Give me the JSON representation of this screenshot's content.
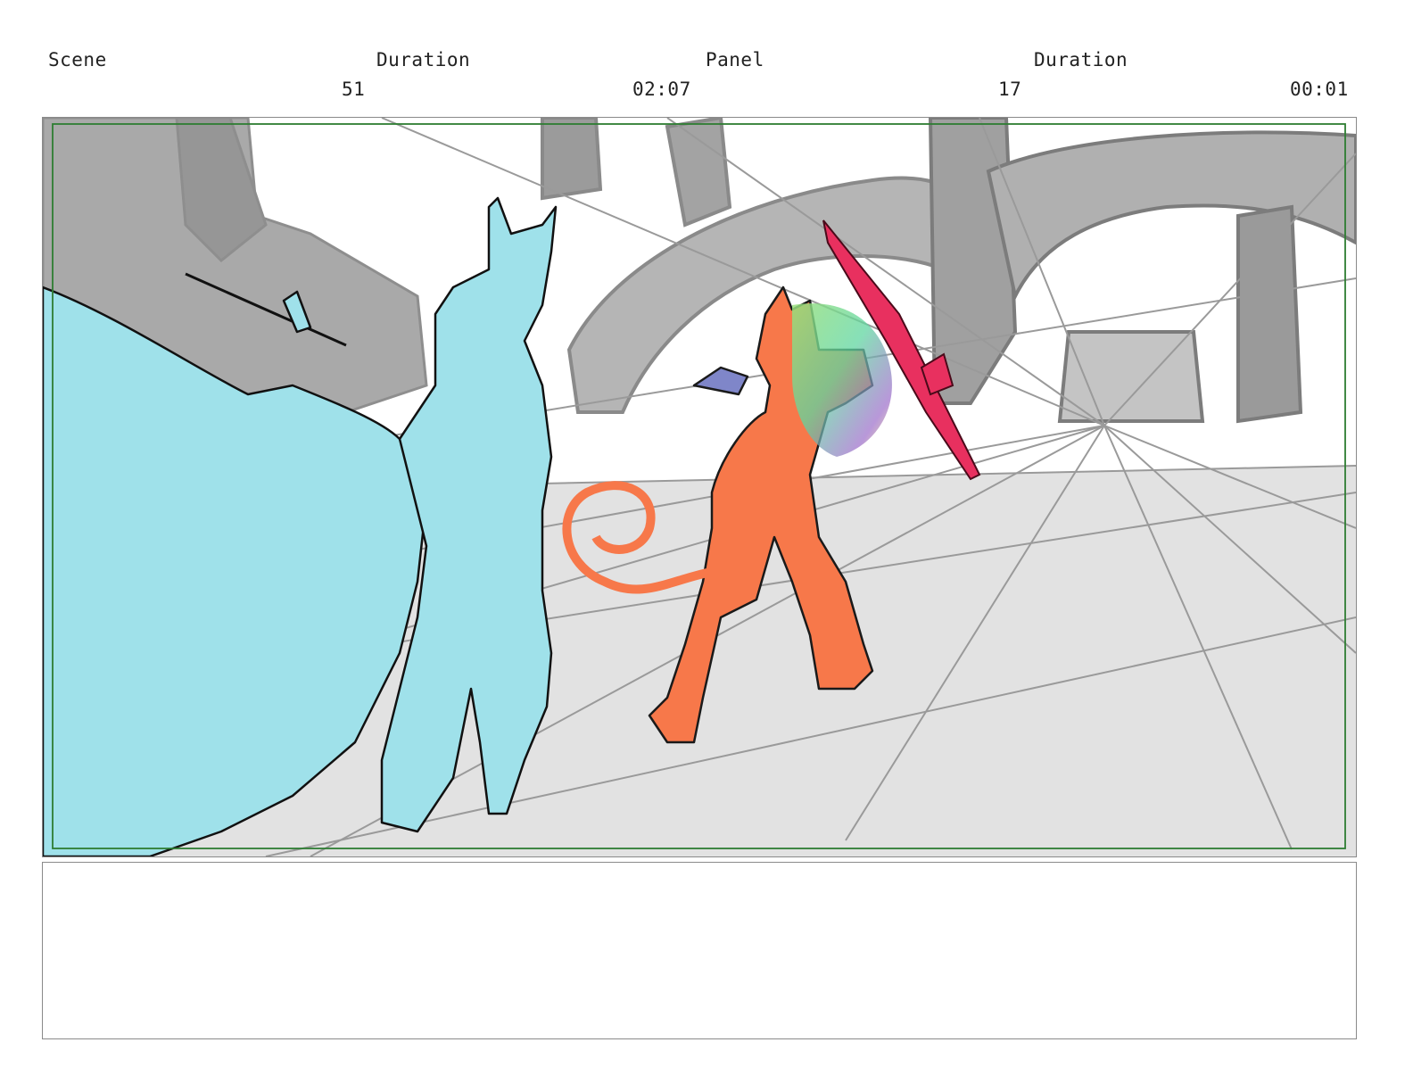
{
  "header": {
    "scene_label": "Scene",
    "scene_duration_label": "Duration",
    "panel_label": "Panel",
    "panel_duration_label": "Duration",
    "scene_number": "51",
    "scene_duration": "02:07",
    "panel_number": "17",
    "panel_duration": "00:01"
  },
  "colors": {
    "safe_area_border": "#2e7d32",
    "cyan_character": "#9fe1ea",
    "orange_character": "#f7784a",
    "red_sword": "#e8305f",
    "floor_gray": "#e0e0e0",
    "architecture_gray": "#a8a8a8",
    "hat_blue": "#7f86c9"
  },
  "notes": {
    "text": ""
  }
}
